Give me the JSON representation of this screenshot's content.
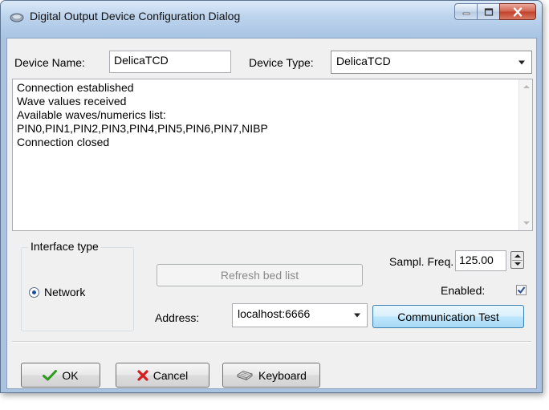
{
  "window": {
    "title": "Digital Output Device Configuration Dialog"
  },
  "device": {
    "name_label": "Device Name:",
    "name_value": "DelicaTCD",
    "type_label": "Device Type:",
    "type_value": "DelicaTCD"
  },
  "log": {
    "lines": [
      "Connection established",
      "Wave values received",
      "Available waves/numerics list:",
      "PIN0,PIN1,PIN2,PIN3,PIN4,PIN5,PIN6,PIN7,NIBP",
      "Connection closed"
    ]
  },
  "interface": {
    "group_title": "Interface type",
    "network_label": "Network",
    "network_selected": true
  },
  "controls": {
    "refresh_label": "Refresh bed list",
    "address_label": "Address:",
    "address_value": "localhost:6666",
    "sampl_freq_label": "Sampl. Freq.",
    "sampl_freq_value": "125.00",
    "enabled_label": "Enabled:",
    "enabled_checked": true,
    "comm_test_label": "Communication Test"
  },
  "footer": {
    "ok_label": "OK",
    "cancel_label": "Cancel",
    "keyboard_label": "Keyboard"
  },
  "colors": {
    "ok_check": "#2e9a1e",
    "cancel_x": "#d21e1e",
    "accent": "#1f4f9a"
  }
}
